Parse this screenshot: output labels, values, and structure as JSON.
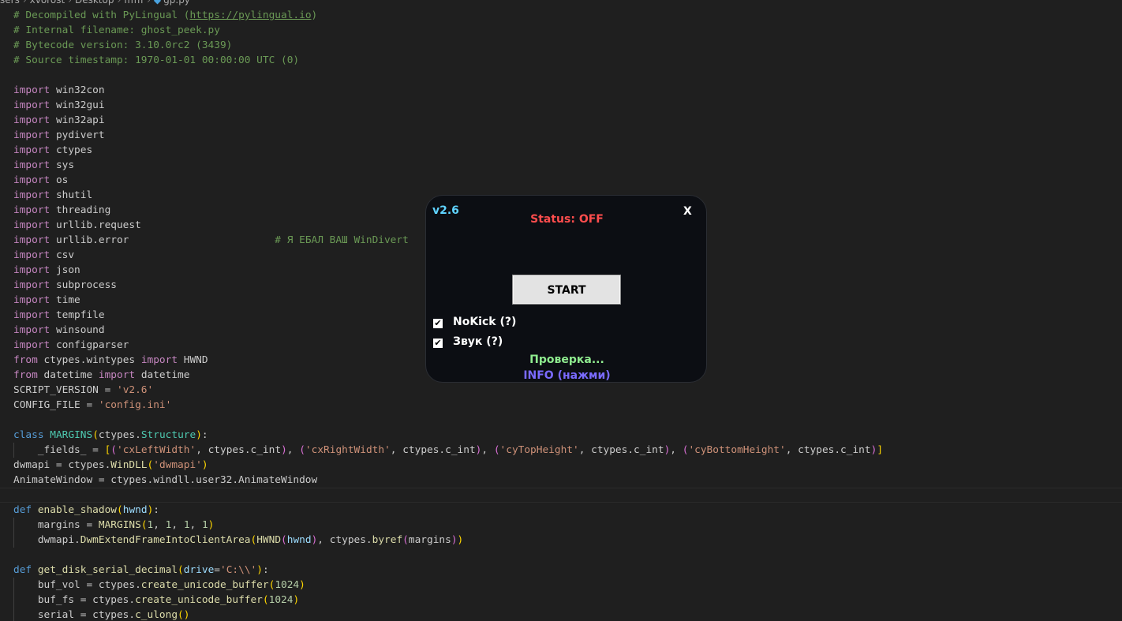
{
  "breadcrumb": {
    "parts": [
      "sers",
      "xvorost",
      "Desktop",
      "ffffff"
    ],
    "file": "gp.py"
  },
  "code": {
    "lines": [
      "# Decompiled with PyLingual (https://pylingual.io)",
      "# Internal filename: ghost_peek.py",
      "# Bytecode version: 3.10.0rc2 (3439)",
      "# Source timestamp: 1970-01-01 00:00:00 UTC (0)",
      "",
      "import win32con",
      "import win32gui",
      "import win32api",
      "import pydivert",
      "import ctypes",
      "import sys",
      "import os",
      "import shutil",
      "import threading",
      "import urllib.request",
      "import urllib.error                        # Я ЕБАЛ ВАШ WinDivert",
      "import csv",
      "import json",
      "import subprocess",
      "import time",
      "import tempfile",
      "import winsound",
      "import configparser",
      "from ctypes.wintypes import HWND",
      "from datetime import datetime",
      "SCRIPT_VERSION = 'v2.6'",
      "CONFIG_FILE = 'config.ini'",
      "",
      "class MARGINS(ctypes.Structure):",
      "    _fields_ = [('cxLeftWidth', ctypes.c_int), ('cxRightWidth', ctypes.c_int), ('cyTopHeight', ctypes.c_int), ('cyBottomHeight', ctypes.c_int)]",
      "dwmapi = ctypes.WinDLL('dwmapi')",
      "AnimateWindow = ctypes.windll.user32.AnimateWindow",
      "",
      "def enable_shadow(hwnd):",
      "    margins = MARGINS(1, 1, 1, 1)",
      "    dwmapi.DwmExtendFrameIntoClientArea(HWND(hwnd), ctypes.byref(margins))",
      "",
      "def get_disk_serial_decimal(drive='C:\\\\'):",
      "    buf_vol = ctypes.create_unicode_buffer(1024)",
      "    buf_fs = ctypes.create_unicode_buffer(1024)",
      "    serial = ctypes.c_ulong()"
    ],
    "current_line": 32
  },
  "overlay": {
    "version": "v2.6",
    "close_label": "X",
    "status": "Status: OFF",
    "start_label": "START",
    "nokick_label": "NoKick (?)",
    "nokick_checked": true,
    "sound_label": "Звук (?)",
    "sound_checked": true,
    "checking_text": "Проверка...",
    "info_label": "INFO (нажми)",
    "colors": {
      "version": "#5fd3ff",
      "status_off": "#ff4d4d",
      "checking": "#8fec8f",
      "info": "#7a6bff"
    }
  }
}
